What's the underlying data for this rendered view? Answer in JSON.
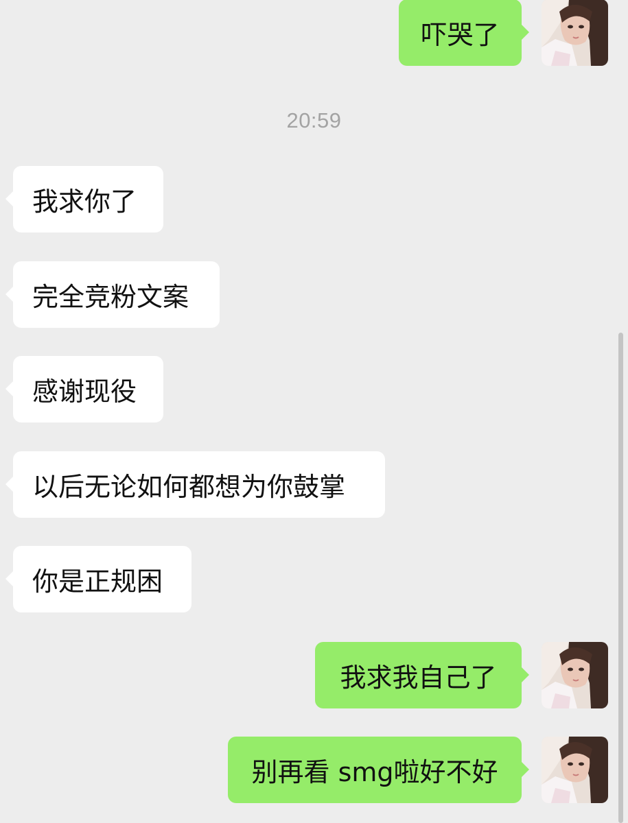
{
  "chat": {
    "timestamp": "20:59",
    "messages": [
      {
        "side": "out",
        "text": "吓哭了"
      },
      {
        "side": "in",
        "text": "我求你了"
      },
      {
        "side": "in",
        "text": "完全竞粉文案"
      },
      {
        "side": "in",
        "text": "感谢现役"
      },
      {
        "side": "in",
        "text": "以后无论如何都想为你鼓掌"
      },
      {
        "side": "in",
        "text": "你是正规困"
      },
      {
        "side": "out",
        "text": "我求我自己了"
      },
      {
        "side": "out",
        "text": "别再看 smg啦好不好"
      }
    ]
  },
  "colors": {
    "background": "#ededed",
    "outgoing_bubble": "#95ec69",
    "incoming_bubble": "#ffffff",
    "timestamp_text": "#a3a3a3"
  },
  "icons": {
    "avatar": "user-photo-avatar"
  }
}
